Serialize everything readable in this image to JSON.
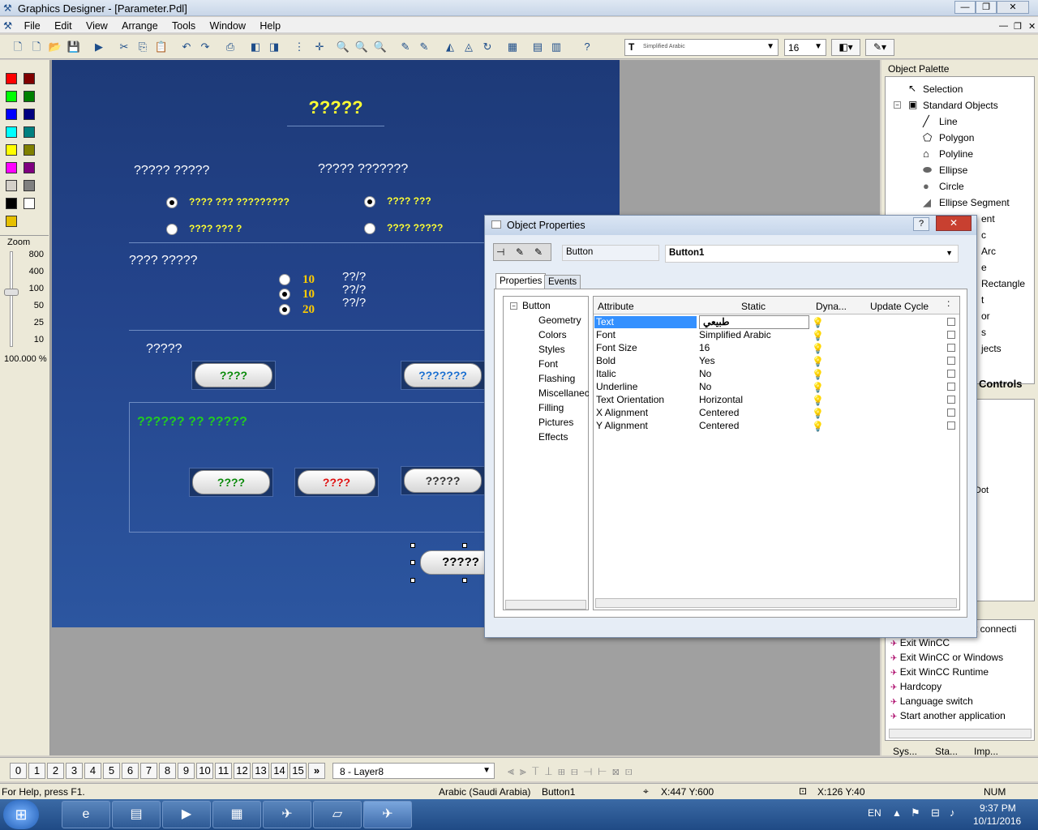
{
  "window": {
    "title": "Graphics Designer - [Parameter.Pdl]"
  },
  "menu": [
    "File",
    "Edit",
    "View",
    "Arrange",
    "Tools",
    "Window",
    "Help"
  ],
  "toolbar": {
    "font_name": "Simplified Arabic",
    "font_size": "16"
  },
  "zoom": {
    "label": "Zoom",
    "levels": [
      "800",
      "400",
      "100",
      "50",
      "25",
      "10"
    ],
    "current": "100.000 %"
  },
  "picture": {
    "title": "?????",
    "group1_label": "????? ?????",
    "group2_label": "????? ???????",
    "opt1": "???? ??? ?????????",
    "opt2": "???? ??? ?",
    "opt3": "???? ???",
    "opt4": "???? ?????",
    "section2_label": "???? ?????",
    "val1": "10",
    "val2": "10",
    "val3": "20",
    "unit1": "??/?",
    "unit2": "??/?",
    "unit3": "??/?",
    "section3_label": "?????",
    "btn1": "????",
    "btn2": "???????",
    "section4_label": "?????? ?? ?????",
    "btn3": "????",
    "btn4": "????",
    "btn5": "?????",
    "btn6": "?????"
  },
  "dialog": {
    "title": "Object Properties",
    "type": "Button",
    "object": "Button1",
    "tabs": [
      "Properties",
      "Events"
    ],
    "tree_root": "Button",
    "tree": [
      "Geometry",
      "Colors",
      "Styles",
      "Font",
      "Flashing",
      "Miscellanec",
      "Filling",
      "Pictures",
      "Effects"
    ],
    "headers": [
      "Attribute",
      "Static",
      "Dyna...",
      "Update Cycle"
    ],
    "rows": [
      {
        "a": "Text",
        "s": "طبيعي"
      },
      {
        "a": "Font",
        "s": "Simplified Arabic"
      },
      {
        "a": "Font Size",
        "s": "16"
      },
      {
        "a": "Bold",
        "s": "Yes"
      },
      {
        "a": "Italic",
        "s": "No"
      },
      {
        "a": "Underline",
        "s": "No"
      },
      {
        "a": "Text Orientation",
        "s": "Horizontal"
      },
      {
        "a": "X Alignment",
        "s": "Centered"
      },
      {
        "a": "Y Alignment",
        "s": "Centered"
      }
    ]
  },
  "palette": {
    "title": "Object Palette",
    "items": [
      "Selection",
      "Standard Objects",
      "Line",
      "Polygon",
      "Polyline",
      "Ellipse",
      "Circle",
      "Ellipse Segment"
    ],
    "partial": [
      "ent",
      "c",
      "Arc",
      "e",
      "Rectangle",
      "t",
      "or",
      "s",
      "jects"
    ],
    "controls_tab": "Controls",
    "dot": "Dot",
    "conn": "t connecti",
    "actions": [
      "Exit WinCC",
      "Exit WinCC or Windows",
      "Exit WinCC Runtime",
      "Hardcopy",
      "Language switch",
      "Start another application"
    ],
    "bottom_tabs": [
      "Sys...",
      "Sta...",
      "Imp..."
    ]
  },
  "layers": {
    "buttons": [
      "0",
      "1",
      "2",
      "3",
      "4",
      "5",
      "6",
      "7",
      "8",
      "9",
      "10",
      "11",
      "12",
      "13",
      "14",
      "15"
    ],
    "current": "8 - Layer8"
  },
  "status": {
    "help": "For Help, press F1.",
    "lang": "Arabic (Saudi Arabia)",
    "obj": "Button1",
    "pos": "X:447 Y:600",
    "size": "X:126 Y:40",
    "num": "NUM"
  },
  "taskbar": {
    "lang": "EN",
    "time": "9:37 PM",
    "date": "10/11/2016"
  }
}
